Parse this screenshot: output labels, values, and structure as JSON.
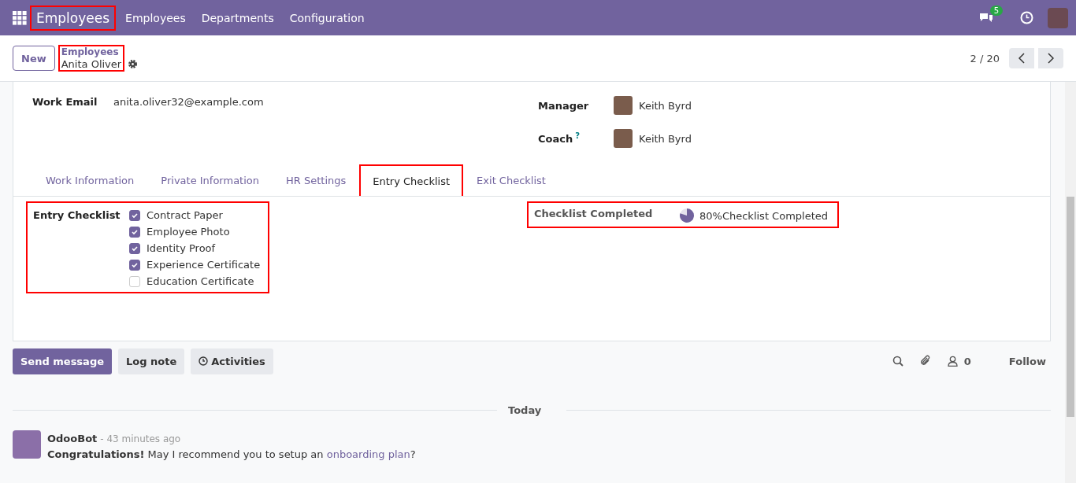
{
  "navbar": {
    "app_name": "Employees",
    "app_highlighted": true,
    "menu": [
      "Employees",
      "Departments",
      "Configuration"
    ],
    "messages_badge": "5"
  },
  "control_panel": {
    "new_button": "New",
    "breadcrumb_parent": "Employees",
    "breadcrumb_current": "Anita Oliver",
    "breadcrumb_highlighted": true,
    "pager": "2 / 20"
  },
  "form": {
    "work_email": {
      "label": "Work Email",
      "value": "anita.oliver32@example.com"
    },
    "manager": {
      "label": "Manager",
      "value": "Keith Byrd"
    },
    "coach": {
      "label": "Coach",
      "help": "?",
      "value": "Keith Byrd"
    },
    "tabs": [
      {
        "label": "Work Information",
        "selected": false,
        "highlighted": false
      },
      {
        "label": "Private Information",
        "selected": false,
        "highlighted": false
      },
      {
        "label": "HR Settings",
        "selected": false,
        "highlighted": false
      },
      {
        "label": "Entry Checklist",
        "selected": true,
        "highlighted": true
      },
      {
        "label": "Exit Checklist",
        "selected": false,
        "highlighted": false
      }
    ],
    "entry_checklist": {
      "label": "Entry Checklist",
      "highlighted": true,
      "items": [
        {
          "label": "Contract Paper",
          "checked": true
        },
        {
          "label": "Employee Photo",
          "checked": true
        },
        {
          "label": "Identity Proof",
          "checked": true
        },
        {
          "label": "Experience Certificate",
          "checked": true
        },
        {
          "label": "Education Certificate",
          "checked": false
        }
      ]
    },
    "checklist_completed": {
      "label": "Checklist Completed",
      "level": 0.8,
      "value": "80%Checklist Completed",
      "highlighted": true
    }
  },
  "chatter": {
    "buttons": [
      {
        "label": "Send message",
        "kind": "primary"
      },
      {
        "label": "Log note",
        "kind": "secondary"
      },
      {
        "label": "Activities",
        "kind": "activities"
      }
    ],
    "followers_count": "0",
    "follow": "Follow",
    "divider": "Today",
    "messages": [
      {
        "author": "OdooBot",
        "time": "- 43 minutes ago",
        "text": "**Congratulations!** May I recommend you to setup an ",
        "link": "onboarding plan",
        "after": "?"
      }
    ]
  }
}
